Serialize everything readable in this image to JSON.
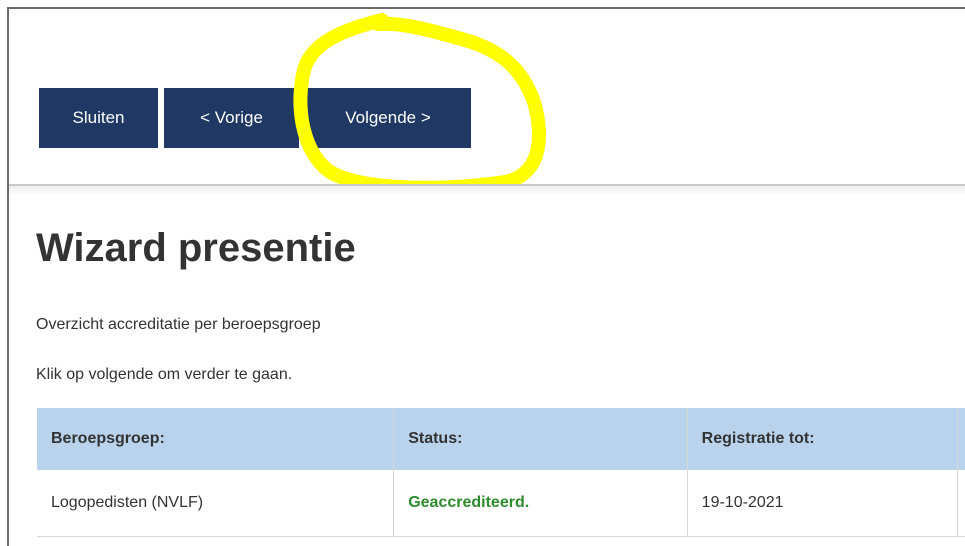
{
  "toolbar": {
    "close_label": "Sluiten",
    "previous_label": "< Vorige",
    "next_label": "Volgende >",
    "button_color": "#1f3864"
  },
  "annotation": {
    "highlight_color": "#ffff00"
  },
  "page": {
    "title": "Wizard presentie",
    "subtitle": "Overzicht accreditatie per beroepsgroep",
    "instruction": "Klik op volgende om verder te gaan."
  },
  "table": {
    "header_color": "#b9d3ec",
    "columns": [
      "Beroepsgroep:",
      "Status:",
      "Registratie tot:"
    ],
    "rows": [
      {
        "beroepsgroep": "Logopedisten (NVLF)",
        "status": "Geaccrediteerd.",
        "registratie_tot": "19-10-2021"
      }
    ]
  },
  "colors": {
    "status_ok": "#2e8b2e",
    "title_text": "#333333"
  }
}
